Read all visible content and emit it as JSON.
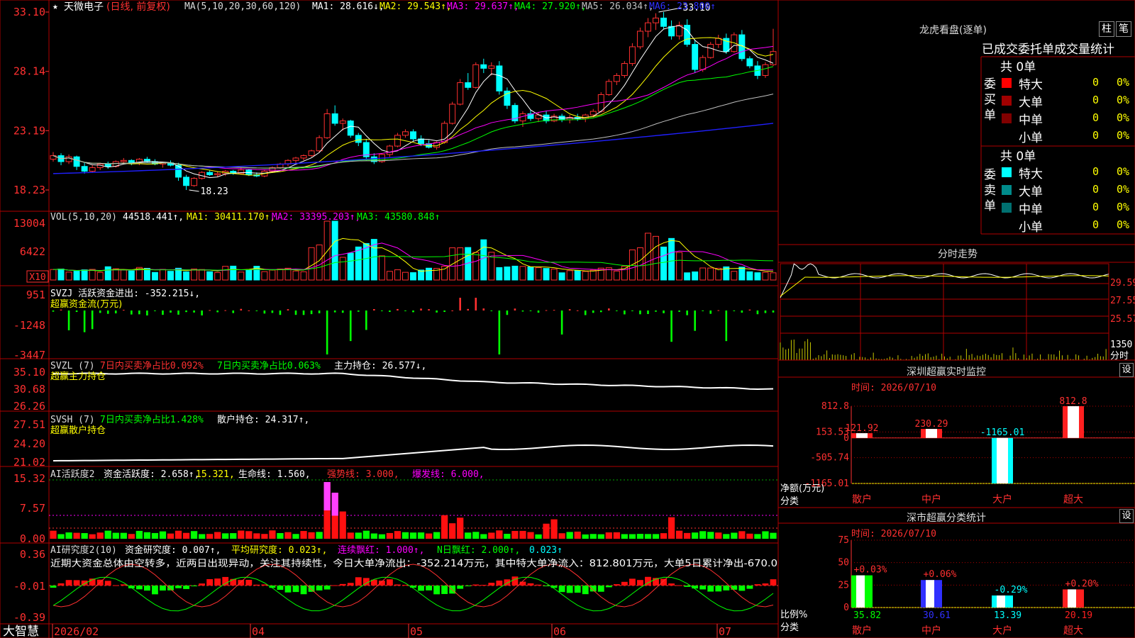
{
  "stock": {
    "name": "天微电子",
    "period_label": "(日线, 前复权)",
    "star": "★",
    "ma_header": [
      {
        "text": "MA(5,10,20,30,60,120)",
        "color": "#dcdcdc"
      },
      {
        "text": "MA1: 28.616↓,",
        "color": "#ffffff"
      },
      {
        "text": "MA2: 29.543↑,",
        "color": "#ffff00"
      },
      {
        "text": "MA3: 29.637↑,",
        "color": "#ff00ff"
      },
      {
        "text": "MA4: 27.920↑,",
        "color": "#00ff00"
      },
      {
        "text": "MA5: 26.034↑,",
        "color": "#c0c0c0"
      },
      {
        "text": "MA6: 23.800↑",
        "color": "#3030ff"
      }
    ],
    "price_ticks": [
      "33.10",
      "28.14",
      "23.19",
      "18.23"
    ],
    "high_label": "33.10",
    "low_label": "18.23",
    "candles": [
      [
        20.8,
        21.4,
        20.6,
        21.1
      ],
      [
        21.1,
        21.3,
        20.3,
        20.6
      ],
      [
        20.6,
        21.2,
        20.4,
        21.0
      ],
      [
        21.0,
        21.1,
        19.9,
        20.2
      ],
      [
        20.2,
        20.5,
        19.6,
        19.8
      ],
      [
        19.8,
        20.3,
        19.7,
        20.1
      ],
      [
        20.1,
        20.5,
        19.9,
        20.4
      ],
      [
        20.4,
        20.6,
        20.0,
        20.2
      ],
      [
        20.2,
        20.7,
        20.1,
        20.6
      ],
      [
        20.6,
        20.9,
        20.4,
        20.7
      ],
      [
        20.7,
        20.8,
        20.3,
        20.5
      ],
      [
        20.5,
        20.9,
        20.3,
        20.8
      ],
      [
        20.8,
        21.0,
        20.5,
        20.6
      ],
      [
        20.6,
        20.8,
        20.3,
        20.4
      ],
      [
        20.4,
        20.6,
        20.1,
        20.5
      ],
      [
        20.5,
        20.7,
        20.2,
        20.3
      ],
      [
        20.3,
        20.5,
        19.0,
        19.3
      ],
      [
        19.3,
        19.5,
        18.23,
        18.6
      ],
      [
        18.6,
        19.3,
        18.5,
        19.2
      ],
      [
        19.2,
        19.8,
        19.1,
        19.7
      ],
      [
        19.7,
        19.9,
        19.4,
        19.5
      ],
      [
        19.5,
        19.8,
        19.3,
        19.6
      ],
      [
        19.6,
        19.9,
        19.4,
        19.8
      ],
      [
        19.8,
        19.9,
        19.5,
        19.6
      ],
      [
        19.6,
        20.1,
        19.5,
        19.9
      ],
      [
        19.9,
        20.0,
        19.4,
        19.5
      ],
      [
        19.5,
        19.7,
        19.3,
        19.4
      ],
      [
        19.4,
        19.9,
        19.3,
        19.8
      ],
      [
        19.8,
        20.2,
        19.7,
        20.1
      ],
      [
        20.1,
        20.5,
        20.0,
        20.4
      ],
      [
        20.4,
        20.8,
        20.2,
        20.7
      ],
      [
        20.7,
        21.0,
        20.5,
        20.9
      ],
      [
        20.9,
        21.2,
        20.7,
        21.1
      ],
      [
        21.1,
        21.6,
        21.0,
        21.5
      ],
      [
        21.5,
        22.8,
        21.4,
        22.6
      ],
      [
        22.6,
        25.0,
        22.5,
        24.6
      ],
      [
        24.6,
        25.3,
        23.6,
        23.8
      ],
      [
        23.8,
        24.2,
        23.2,
        24.0
      ],
      [
        24.0,
        24.1,
        22.6,
        22.8
      ],
      [
        22.8,
        23.0,
        21.9,
        22.2
      ],
      [
        22.2,
        22.5,
        20.7,
        21.0
      ],
      [
        21.0,
        21.3,
        20.4,
        20.6
      ],
      [
        20.6,
        21.3,
        20.5,
        21.2
      ],
      [
        21.2,
        22.0,
        21.0,
        21.9
      ],
      [
        21.9,
        23.0,
        21.8,
        22.8
      ],
      [
        22.8,
        23.3,
        22.6,
        23.1
      ],
      [
        23.1,
        23.3,
        22.3,
        22.5
      ],
      [
        22.5,
        22.8,
        21.9,
        22.1
      ],
      [
        22.1,
        22.4,
        21.7,
        21.8
      ],
      [
        21.8,
        22.3,
        21.6,
        22.2
      ],
      [
        22.2,
        24.0,
        22.1,
        23.8
      ],
      [
        23.8,
        25.6,
        23.7,
        25.4
      ],
      [
        25.4,
        27.5,
        25.3,
        27.2
      ],
      [
        27.2,
        28.0,
        26.6,
        26.8
      ],
      [
        26.8,
        28.9,
        26.7,
        28.7
      ],
      [
        28.7,
        29.2,
        28.0,
        28.4
      ],
      [
        28.4,
        28.9,
        27.8,
        28.6
      ],
      [
        28.6,
        29.0,
        26.2,
        26.5
      ],
      [
        26.5,
        26.8,
        25.0,
        25.3
      ],
      [
        25.3,
        25.5,
        23.8,
        24.0
      ],
      [
        24.0,
        24.8,
        23.5,
        24.6
      ],
      [
        24.6,
        24.9,
        24.0,
        24.2
      ],
      [
        24.2,
        24.7,
        23.9,
        24.5
      ],
      [
        24.5,
        24.8,
        23.8,
        24.0
      ],
      [
        24.0,
        24.6,
        23.9,
        24.4
      ],
      [
        24.4,
        24.6,
        23.9,
        24.1
      ],
      [
        24.1,
        24.5,
        23.8,
        24.3
      ],
      [
        24.3,
        24.6,
        24.0,
        24.2
      ],
      [
        24.2,
        24.6,
        23.9,
        24.5
      ],
      [
        24.5,
        25.0,
        24.3,
        24.8
      ],
      [
        24.8,
        26.4,
        24.7,
        26.2
      ],
      [
        26.2,
        27.5,
        26.1,
        27.3
      ],
      [
        27.3,
        28.0,
        27.0,
        27.8
      ],
      [
        27.8,
        29.0,
        27.6,
        28.8
      ],
      [
        28.8,
        30.5,
        28.6,
        30.2
      ],
      [
        30.2,
        31.8,
        30.0,
        31.5
      ],
      [
        31.5,
        32.6,
        31.0,
        32.2
      ],
      [
        32.2,
        33.0,
        31.6,
        32.6
      ],
      [
        32.6,
        33.1,
        31.7,
        31.9
      ],
      [
        31.9,
        32.4,
        30.8,
        31.1
      ],
      [
        31.1,
        32.3,
        30.8,
        32.0
      ],
      [
        32.0,
        32.5,
        30.2,
        30.4
      ],
      [
        30.4,
        30.8,
        28.0,
        28.3
      ],
      [
        28.3,
        29.5,
        28.1,
        29.3
      ],
      [
        29.3,
        30.6,
        29.2,
        30.4
      ],
      [
        30.4,
        31.2,
        30.1,
        30.9
      ],
      [
        30.9,
        31.3,
        29.6,
        29.8
      ],
      [
        29.8,
        31.4,
        29.7,
        31.2
      ],
      [
        31.2,
        31.6,
        29.0,
        29.2
      ],
      [
        29.2,
        29.4,
        28.4,
        28.6
      ],
      [
        28.6,
        29.0,
        27.5,
        27.8
      ],
      [
        27.8,
        28.9,
        27.6,
        28.7
      ],
      [
        28.7,
        31.7,
        28.6,
        29.8
      ]
    ],
    "volume_ticks": [
      "13004",
      "6422",
      "X10"
    ],
    "volume_header": [
      {
        "text": "VOL(5,10,20)",
        "color": "#dcdcdc"
      },
      {
        "text": "44518.441↑,",
        "color": "#ffffff"
      },
      {
        "text": "MA1: 30411.170↑,",
        "color": "#ffff00"
      },
      {
        "text": "MA2: 33395.203↑,",
        "color": "#ff00ff"
      },
      {
        "text": "MA3: 43580.848↑",
        "color": "#00ff00"
      }
    ],
    "svzj_header": "SVZJ  活跃资金进出: -352.215↓,",
    "svzj_sub": "超赢资金流(万元)",
    "svzj_ticks": [
      "951",
      "-1248",
      "-3447"
    ],
    "svzl_header": [
      {
        "text": "SVZL (7)",
        "color": "#dcdcdc"
      },
      {
        "text": "7日内买卖净占比0.092%",
        "color": "#ff3030"
      },
      {
        "text": "7日内买卖净占比0.063%",
        "color": "#00ff00"
      },
      {
        "text": "主力持仓: 26.577↓,",
        "color": "#ffffff"
      }
    ],
    "svzl_sub": "超赢主力持仓",
    "svzl_ticks": [
      "35.10",
      "30.68",
      "26.26"
    ],
    "svsh_header": [
      {
        "text": "SVSH (7)",
        "color": "#dcdcdc"
      },
      {
        "text": "7日内买卖净占比1.428%",
        "color": "#00ff00"
      },
      {
        "text": "散户持仓: 24.317↑,",
        "color": "#ffffff"
      }
    ],
    "svsh_sub": "超赢散户持仓",
    "svsh_ticks": [
      "27.51",
      "24.20",
      "21.02"
    ],
    "ai1_header": [
      {
        "text": "AI活跃度2",
        "color": "#dcdcdc"
      },
      {
        "text": "资金活跃度: 2.658↑,",
        "color": "#ffffff"
      },
      {
        "text": "15.321,",
        "color": "#ffff00"
      },
      {
        "text": "生命线: 1.560,",
        "color": "#ffffff"
      },
      {
        "text": "强势线: 3.000,",
        "color": "#ff3030"
      },
      {
        "text": "爆发线: 6.000,",
        "color": "#ff00ff"
      }
    ],
    "ai1_ticks": [
      "15.32",
      "7.57",
      "0.00"
    ],
    "ai2_header": [
      {
        "text": "AI研究度2(10)",
        "color": "#dcdcdc"
      },
      {
        "text": "资金研究度: 0.007↑,",
        "color": "#ffffff"
      },
      {
        "text": "平均研究度: 0.023↑,",
        "color": "#ffff00"
      },
      {
        "text": "连续飘红: 1.000↑,",
        "color": "#ff00ff"
      },
      {
        "text": "N日飘红: 2.000↑,",
        "color": "#00ff00"
      },
      {
        "text": "0.023↑",
        "color": "#00ffff"
      }
    ],
    "ai2_comment": "近期大资金总体由空转多，近两日出现异动，关注其持续性，今日大单净流出：-352.214万元，其中特大单净流入：812.801万元，大单5日累计净出-670.0",
    "ai2_ticks": [
      "0.36",
      "-0.01",
      "-0.39"
    ],
    "date_labels": [
      "2026/02",
      "04",
      "05",
      "06",
      "07"
    ],
    "brand": "大智慧"
  },
  "longhu": {
    "title": "龙虎看盘(逐单)",
    "tab1": "柱",
    "tab2": "笔",
    "subtitle": "已成交委托单成交量统计",
    "buy_label": "委买单",
    "sell_label": "委卖单",
    "buy_total": "共 0单",
    "sell_total": "共 0单",
    "buy_rows": [
      {
        "name": "特大",
        "count": "0",
        "pct": "0%",
        "color": "#ff0000"
      },
      {
        "name": "大单",
        "count": "0",
        "pct": "0%",
        "color": "#a00000"
      },
      {
        "name": "中单",
        "count": "0",
        "pct": "0%",
        "color": "#800000"
      },
      {
        "name": "小单",
        "count": "0",
        "pct": "0%",
        "color": ""
      }
    ],
    "sell_rows": [
      {
        "name": "特大",
        "count": "0",
        "pct": "0%",
        "color": "#00ffff"
      },
      {
        "name": "大单",
        "count": "0",
        "pct": "0%",
        "color": "#008b8b"
      },
      {
        "name": "中单",
        "count": "0",
        "pct": "0%",
        "color": "#007070"
      },
      {
        "name": "小单",
        "count": "0",
        "pct": "0%",
        "color": ""
      }
    ]
  },
  "intraday": {
    "title": "分时走势",
    "price_ticks": [
      "29.59",
      "27.55",
      "25.57"
    ],
    "vol_tick": "1350",
    "vol_unit": "分时"
  },
  "sz_monitor": {
    "title": "深圳超赢实时监控",
    "setting": "设",
    "time_label": "时间: 2026/07/10",
    "y_ticks": [
      "812.8",
      "153.53",
      "0",
      "-505.74",
      "-1165.01"
    ],
    "y_unit": "净额(万元)",
    "x_unit": "分类",
    "categories": [
      "散户",
      "中户",
      "大户",
      "超大"
    ],
    "values": [
      121.92,
      230.29,
      -1165.01,
      812.8
    ],
    "value_labels": [
      "121.92",
      "230.29",
      "-1165.01",
      "812.8"
    ]
  },
  "sz_stats": {
    "title": "深市超赢分类统计",
    "setting": "设",
    "time_label": "时间: 2026/07/10",
    "y_ticks": [
      "75",
      "50",
      "25",
      "0"
    ],
    "y_unit": "比例%",
    "x_unit": "分类",
    "categories": [
      "散户",
      "中户",
      "大户",
      "超大"
    ],
    "values": [
      35.82,
      30.61,
      13.39,
      20.19
    ],
    "change_labels": [
      "+0.03%",
      "+0.06%",
      "-0.29%",
      "+0.20%"
    ],
    "bar_colors": [
      "#00ff00",
      "#3030ff",
      "#00ffff",
      "#ff2020"
    ]
  },
  "chart_data": [
    {
      "type": "bar",
      "title": "深圳超赢实时监控",
      "xlabel": "分类",
      "ylabel": "净额(万元)",
      "categories": [
        "散户",
        "中户",
        "大户",
        "超大"
      ],
      "values": [
        121.92,
        230.29,
        -1165.01,
        812.8
      ],
      "ylim": [
        -1165.01,
        812.8
      ]
    },
    {
      "type": "bar",
      "title": "深市超赢分类统计",
      "xlabel": "分类",
      "ylabel": "比例%",
      "categories": [
        "散户",
        "中户",
        "大户",
        "超大"
      ],
      "values": [
        35.82,
        30.61,
        13.39,
        20.19
      ],
      "ylim": [
        0,
        75
      ]
    }
  ]
}
